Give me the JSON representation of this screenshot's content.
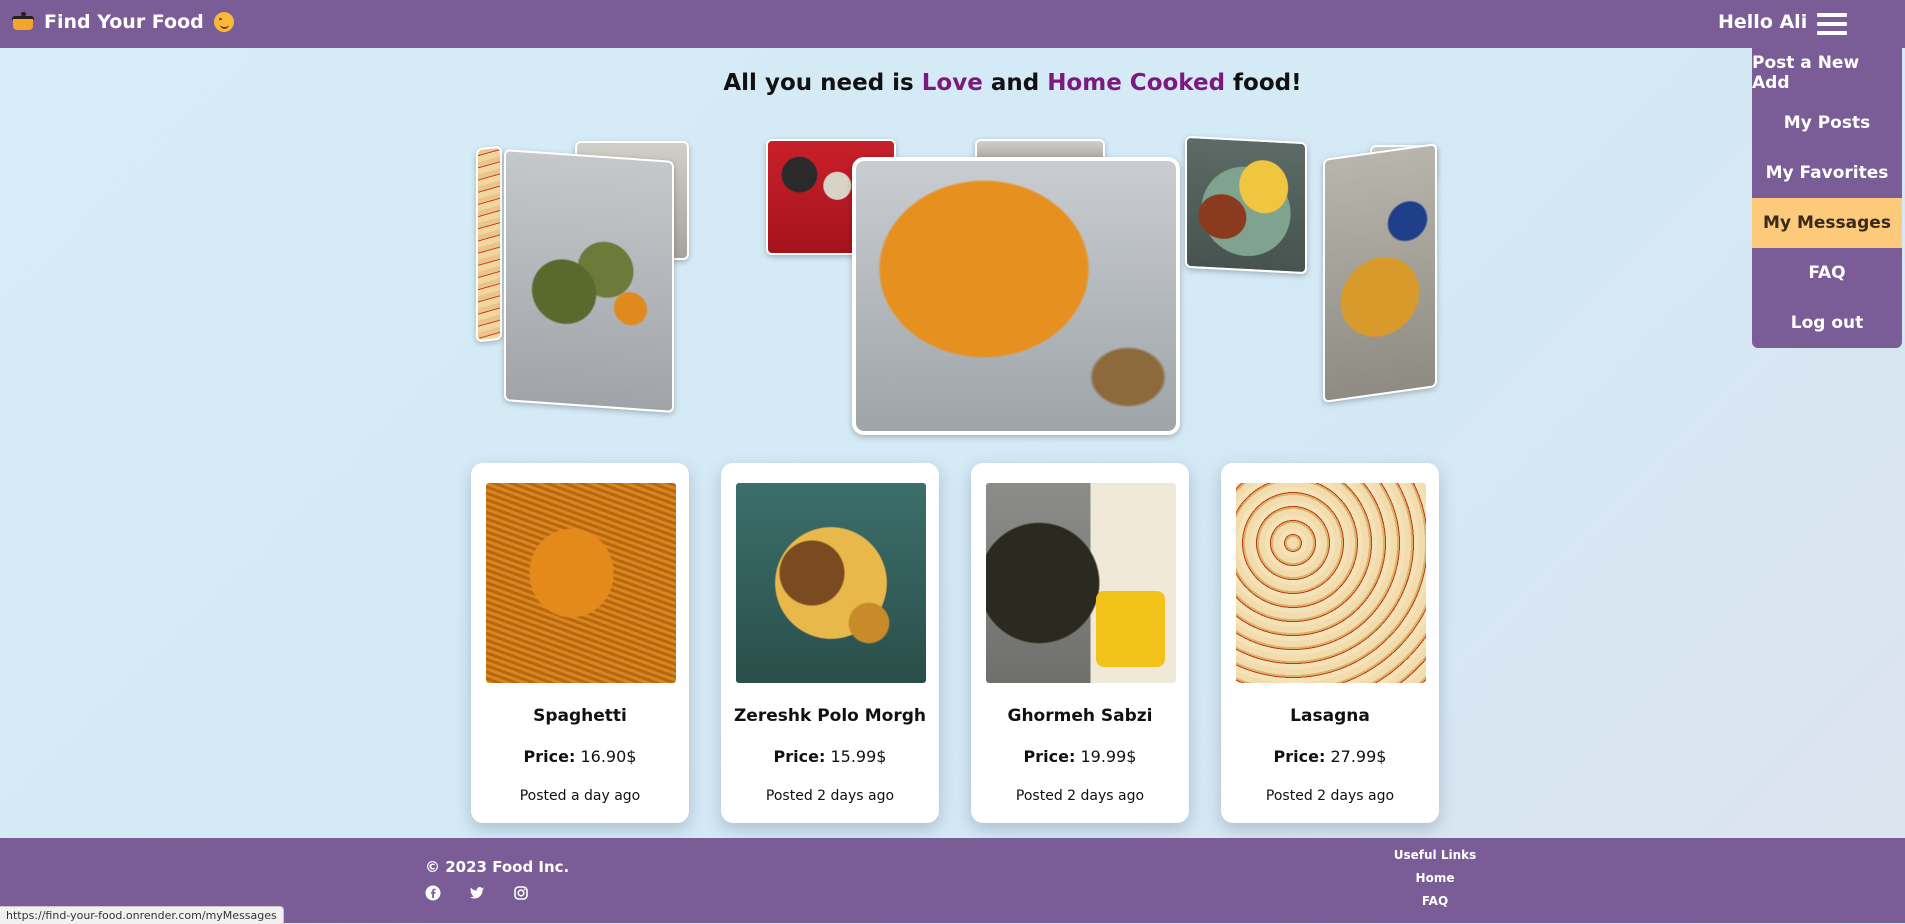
{
  "nav": {
    "brand": "Find Your Food",
    "greeting": "Hello Ali"
  },
  "menu": {
    "items": [
      {
        "label": "Post a New Add",
        "active": false
      },
      {
        "label": "My Posts",
        "active": false
      },
      {
        "label": "My Favorites",
        "active": false
      },
      {
        "label": "My Messages",
        "active": true
      },
      {
        "label": "FAQ",
        "active": false
      },
      {
        "label": "Log out",
        "active": false
      }
    ]
  },
  "headline": {
    "prefix": "All you need is ",
    "love": "Love",
    "and": " and ",
    "home_cooked": "Home Cooked",
    "suffix": " food!"
  },
  "cards": [
    {
      "name": "Spaghetti",
      "price_label": "Price:",
      "price": "16.90$",
      "posted": "Posted a day ago"
    },
    {
      "name": "Zereshk Polo Morgh",
      "price_label": "Price:",
      "price": "15.99$",
      "posted": "Posted 2 days ago"
    },
    {
      "name": "Ghormeh Sabzi",
      "price_label": "Price:",
      "price": "19.99$",
      "posted": "Posted 2 days ago"
    },
    {
      "name": "Lasagna",
      "price_label": "Price:",
      "price": "27.99$",
      "posted": "Posted 2 days ago"
    }
  ],
  "footer": {
    "copyright": "© 2023 Food Inc.",
    "useful_links_title": "Useful Links",
    "links": [
      "Home",
      "FAQ"
    ],
    "socials": [
      "facebook-icon",
      "twitter-icon",
      "instagram-icon"
    ]
  },
  "statusbar": {
    "url": "https://find-your-food.onrender.com/myMessages"
  },
  "colors": {
    "primary": "#7a5c96",
    "accent": "#7b1a7e",
    "active_menu": "#fdc97a"
  }
}
